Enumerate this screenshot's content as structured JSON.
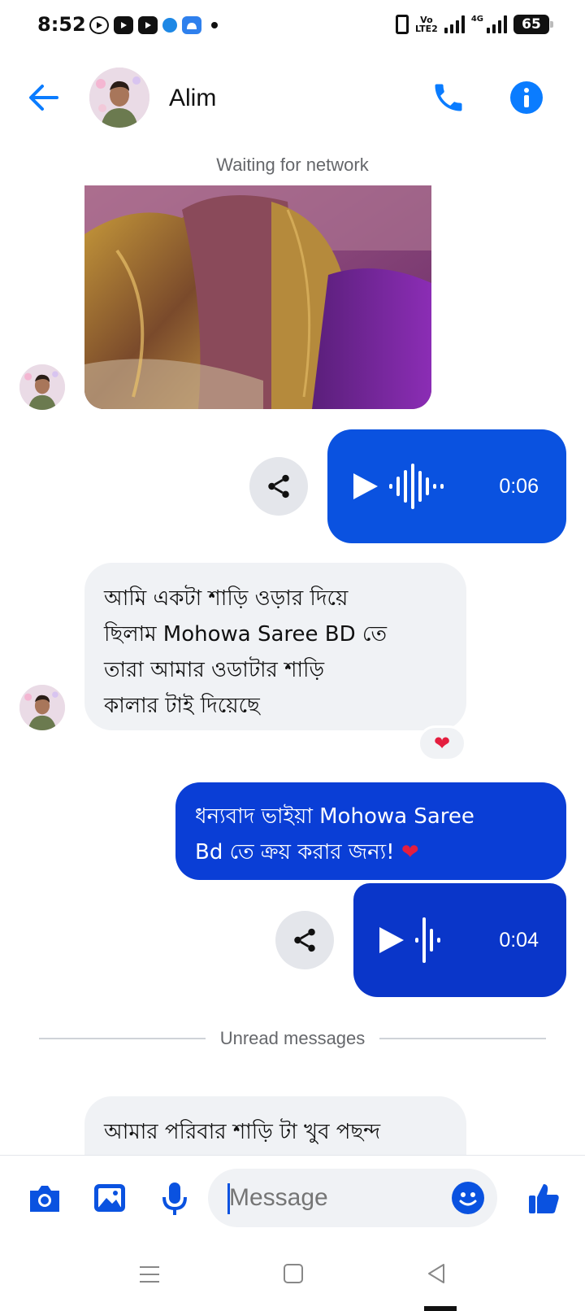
{
  "status_bar": {
    "time": "8:52",
    "volte_top": "Vo",
    "volte_bottom": "LTE2",
    "net_type": "4G",
    "battery": "65"
  },
  "header": {
    "contact_name": "Alim",
    "back_icon": "arrow-left-icon",
    "call_icon": "phone-icon",
    "info_icon": "info-icon"
  },
  "network_status": "Waiting for network",
  "messages": {
    "voice_1": {
      "duration": "0:06"
    },
    "incoming_1": {
      "line1": "আমি একটা শাড়ি  ওড়ার দিয়ে",
      "line2": "ছিলাম Mohowa Saree BD তে",
      "line3": "তারা আমার ওডাটার শাড়ি",
      "line4": "কালার টাই দিয়েছে",
      "reaction": "❤"
    },
    "outgoing_1": {
      "line1": "ধন্যবাদ ভাইয়া Mohowa Saree",
      "line2": "Bd তে ক্রয় করার জন্য!",
      "emoji": "❤"
    },
    "voice_2": {
      "duration": "0:04"
    },
    "unread_divider": "Unread messages",
    "incoming_2": {
      "line1": "আমার পরিবার শাড়ি টা খুব পছন্দ"
    }
  },
  "composer": {
    "placeholder": "Message"
  },
  "colors": {
    "accent": "#0a7cff",
    "outgoing_bubble": "#0a3ed6",
    "incoming_bubble": "#f0f2f5",
    "reaction_heart": "#e41e3f"
  }
}
